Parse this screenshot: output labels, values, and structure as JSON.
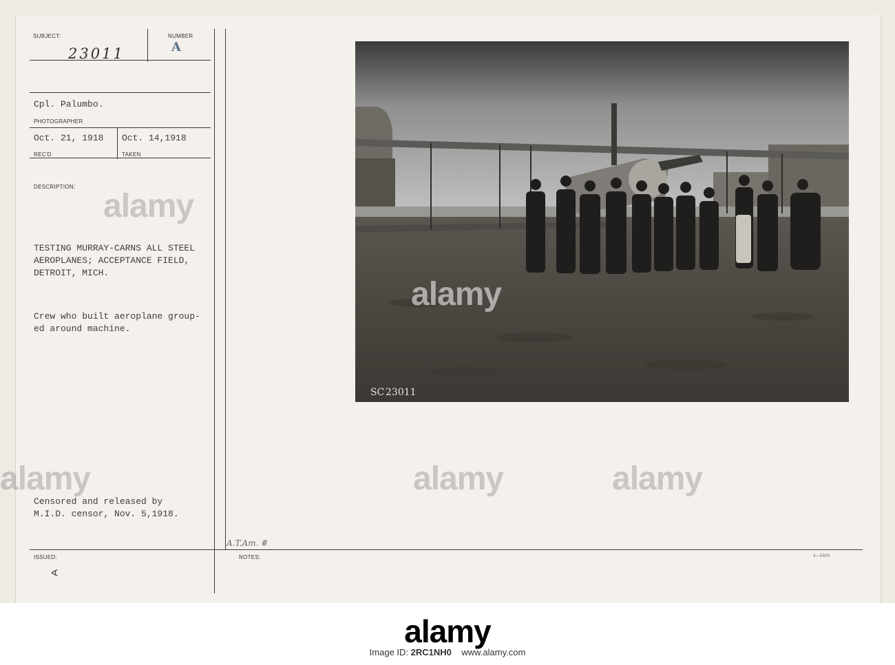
{
  "card": {
    "subject_label": "SUBJECT:",
    "subject_number": "23011",
    "number_label": "NUMBER",
    "number_value": "A",
    "photographer_name": "Cpl. Palumbo.",
    "photographer_label": "PHOTOGRAPHER",
    "received_date": "Oct. 21, 1918",
    "received_label": "REC'D",
    "taken_date": "Oct. 14,1918",
    "taken_label": "TAKEN",
    "description_label": "DESCRIPTION:",
    "title_lines": [
      "TESTING MURRAY-CARNS ALL STEEL",
      "AEROPLANES; ACCEPTANCE FIELD,",
      "DETROIT, MICH."
    ],
    "caption_lines": [
      "Crew who built aeroplane group-",
      "ed around machine."
    ],
    "censor_lines": [
      "Censored and released by",
      "M.I.D. censor, Nov. 5,1918."
    ],
    "issued_label": "ISSUED:",
    "issued_mark": "∢",
    "notes_label": "NOTES:",
    "notes_handwritten": "A.T.Am. #",
    "form_number": "3—5605",
    "photo_number": "23011",
    "photo_monogram": "SC"
  },
  "watermark": "alamy",
  "footer": {
    "logo": "alamy",
    "image_id_label": "Image ID:",
    "image_id": "2RC1NH0",
    "url": "www.alamy.com"
  }
}
